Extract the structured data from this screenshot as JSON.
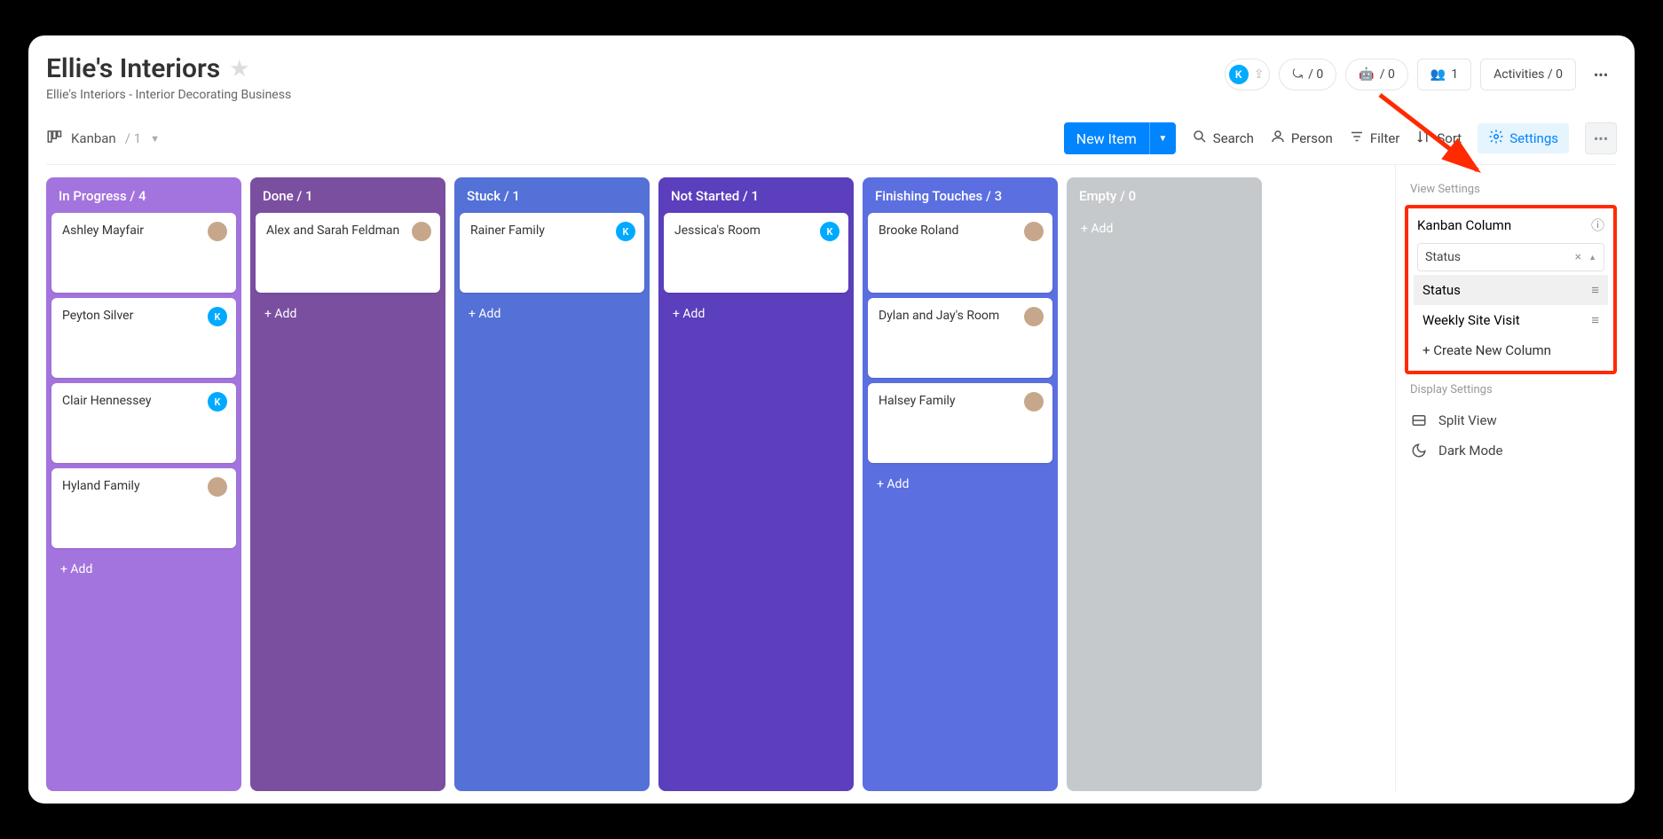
{
  "header": {
    "title": "Ellie's Interiors",
    "subtitle": "Ellie's Interiors - Interior Decorating Business",
    "userBadge": "K",
    "counter1": "/ 0",
    "counter2": "/ 0",
    "membersLabel": "1",
    "activitiesLabel": "Activities / 0"
  },
  "viewTab": {
    "name": "Kanban",
    "count": "/ 1"
  },
  "toolbar": {
    "newItem": "New Item",
    "search": "Search",
    "person": "Person",
    "filter": "Filter",
    "sort": "Sort",
    "settings": "Settings"
  },
  "columns": [
    {
      "title": "In Progress / 4",
      "color": "#a374dd",
      "addLabel": "+ Add",
      "cards": [
        {
          "name": "Ashley Mayfair",
          "avatar": "photo"
        },
        {
          "name": "Peyton Silver",
          "avatar": "K"
        },
        {
          "name": "Clair Hennessey",
          "avatar": "K"
        },
        {
          "name": "Hyland Family",
          "avatar": "photo"
        }
      ]
    },
    {
      "title": "Done / 1",
      "color": "#7b4fa0",
      "addLabel": "+ Add",
      "cards": [
        {
          "name": "Alex and Sarah Feldman",
          "avatar": "photo"
        }
      ]
    },
    {
      "title": "Stuck / 1",
      "color": "#5371d6",
      "addLabel": "+ Add",
      "cards": [
        {
          "name": "Rainer Family",
          "avatar": "K"
        }
      ]
    },
    {
      "title": "Not Started / 1",
      "color": "#5b3fbc",
      "addLabel": "+ Add",
      "cards": [
        {
          "name": "Jessica's Room",
          "avatar": "K"
        }
      ]
    },
    {
      "title": "Finishing Touches / 3",
      "color": "#5b6fe0",
      "addLabel": "+ Add",
      "cards": [
        {
          "name": "Brooke Roland",
          "avatar": "photo"
        },
        {
          "name": "Dylan and Jay's Room",
          "avatar": "photo"
        },
        {
          "name": "Halsey Family",
          "avatar": "photo"
        }
      ]
    },
    {
      "title": "Empty / 0",
      "color": "#c6c9cc",
      "addLabel": "+ Add",
      "cards": []
    }
  ],
  "sidebar": {
    "viewSettings": "View Settings",
    "kanbanColumn": "Kanban Column",
    "selected": "Status",
    "options": [
      "Status",
      "Weekly Site Visit"
    ],
    "create": "+ Create New Column",
    "displaySettings": "Display Settings",
    "splitView": "Split View",
    "darkMode": "Dark Mode"
  }
}
